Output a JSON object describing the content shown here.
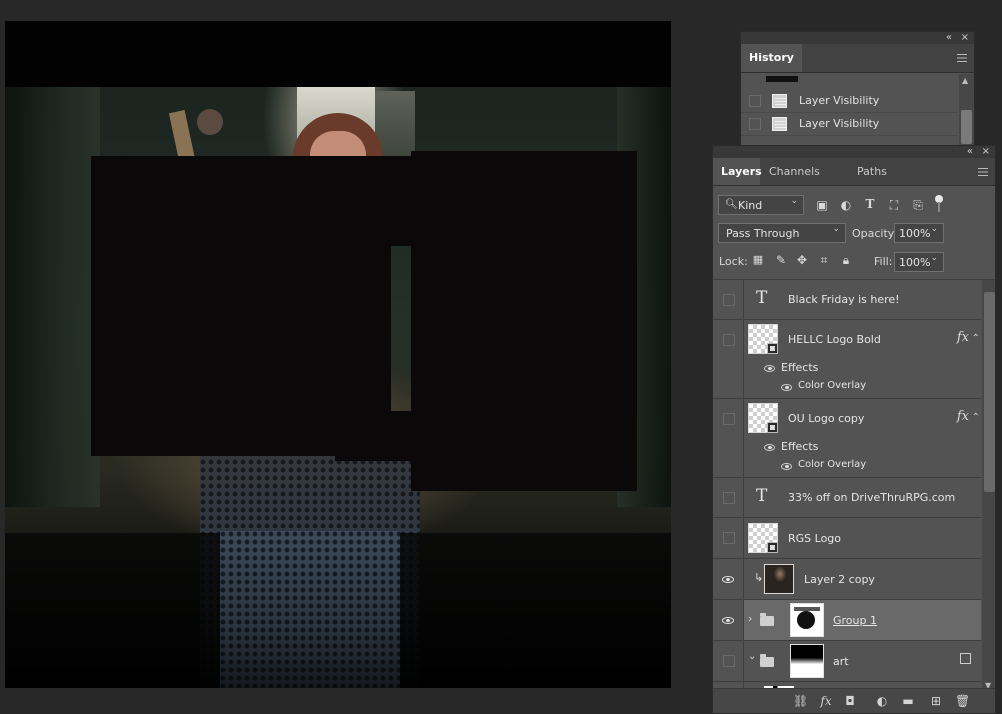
{
  "history": {
    "tab_label": "History",
    "collapse_glyph": "«",
    "close_glyph": "×",
    "rows": [
      {
        "label": "Layer Visibility"
      },
      {
        "label": "Layer Visibility"
      }
    ]
  },
  "layers_panel": {
    "collapse_glyph": "«",
    "close_glyph": "×",
    "tabs": [
      {
        "label": "Layers"
      },
      {
        "label": "Channels"
      },
      {
        "label": "Paths"
      }
    ],
    "filter": {
      "value": "Kind"
    },
    "blend_mode": {
      "value": "Pass Through"
    },
    "opacity": {
      "label": "Opacity:",
      "value": "100%"
    },
    "lock": {
      "label": "Lock:"
    },
    "fill": {
      "label": "Fill:",
      "value": "100%"
    },
    "icons": {
      "filter_pixel": "image-icon",
      "filter_adjust": "circle-half-icon",
      "filter_type": "type-icon",
      "filter_shape": "shape-icon",
      "filter_smart": "smart-object-icon",
      "filter_toggle": "toggle-icon"
    },
    "layers": [
      {
        "name": "Black Friday is here!",
        "kind": "text",
        "visible": false
      },
      {
        "name": "HELLC Logo Bold",
        "kind": "smart",
        "visible": false,
        "fx": true,
        "effects_label": "Effects",
        "effect": "Color Overlay"
      },
      {
        "name": "OU Logo copy",
        "kind": "smart",
        "visible": false,
        "fx": true,
        "effects_label": "Effects",
        "effect": "Color Overlay"
      },
      {
        "name": "33% off on DriveThruRPG.com",
        "kind": "text",
        "visible": false
      },
      {
        "name": "RGS Logo",
        "kind": "smart",
        "visible": false
      },
      {
        "name": "Layer 2 copy",
        "kind": "pixel",
        "visible": true,
        "clipped": true
      },
      {
        "name": "Group 1",
        "kind": "group",
        "visible": true,
        "selected": true
      },
      {
        "name": "art",
        "kind": "group",
        "visible": false,
        "expanded": true
      }
    ],
    "fx_glyph": "fx",
    "bottom_icons": [
      "link-icon",
      "fx-icon",
      "mask-icon",
      "adjustment-icon",
      "folder-icon",
      "new-layer-icon",
      "trash-icon"
    ]
  }
}
